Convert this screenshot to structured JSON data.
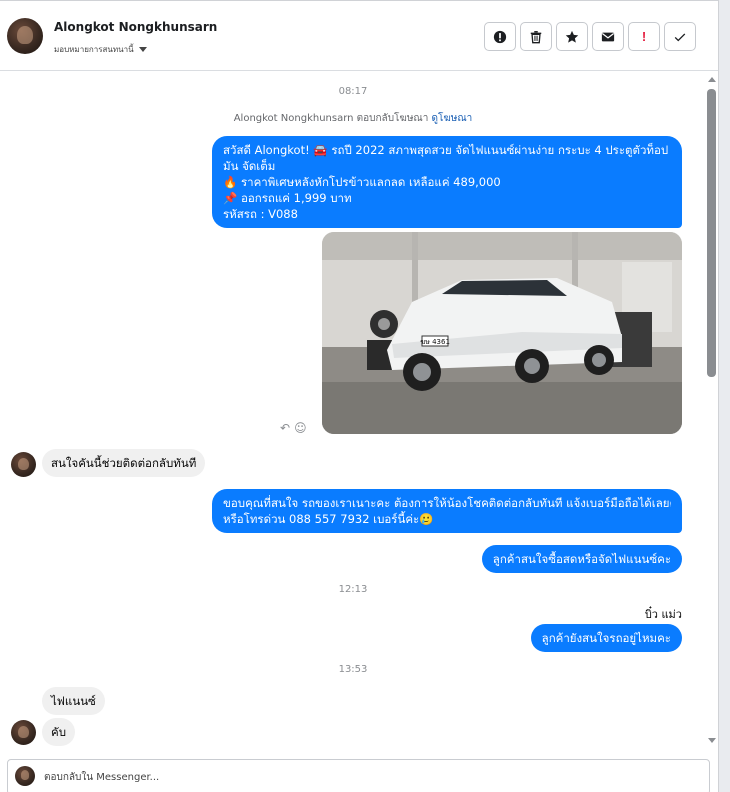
{
  "header": {
    "contact_name": "Alongkot Nongkhunsarn",
    "assign_label": "มอบหมายการสนทนานี้",
    "actions": [
      {
        "icon": "alert-circle-icon",
        "label": ""
      },
      {
        "icon": "trash-icon",
        "label": ""
      },
      {
        "icon": "star-icon",
        "label": ""
      },
      {
        "icon": "envelope-icon",
        "label": ""
      },
      {
        "icon": "exclamation-icon",
        "label": "!"
      },
      {
        "icon": "checkmark-icon",
        "label": ""
      }
    ]
  },
  "thread": {
    "timestamps": [
      "08:17",
      "12:13",
      "13:53"
    ],
    "ad_note": {
      "text": "Alongkot Nongkhunsarn ตอบกลับโฆษณา",
      "link": "ดูโฆษณา"
    },
    "promo_lines": [
      "สวัสดี Alongkot! 🚘 รถปี 2022 สภาพสุดสวย จัดไฟแนนซ์ผ่านง่าย กระบะ 4 ประตูตัวท็อป ขับ",
      "มัน จัดเต็ม",
      "🔥 ราคาพิเศษหลังหักโปรข้าวแลกลด เหลือแค่ 489,000",
      "📌 ออกรถแค่ 1,999 บาท",
      "รหัสรถ : V088"
    ],
    "car_plate": "ฆษ 4361",
    "msg_interest": "สนใจคันนี้ช่วยติดต่อกลับทันที",
    "reply_thanks_1": "ขอบคุณที่สนใจ รถของเราเนาะคะ ต้องการให้น้องโชคติดต่อกลับทันที แจ้งเบอร์มือถือได้เลยค่ะ",
    "reply_thanks_2": "หรือโทรด่วน 088 557 7932 เบอร์นี้ค่ะ🥲",
    "reply_cash_or_finance": "ลูกค้าสนใจซื้อสดหรือจัดไฟแนนซ์คะ",
    "signer": "บิ๋ว แม่ว",
    "reply_still_interested": "ลูกค้ายังสนใจรถอยู่ไหมคะ",
    "msg_finance": "ไฟแนนซ์",
    "msg_yes": "คับ"
  },
  "composer": {
    "placeholder": "ตอบกลับใน Messenger..."
  }
}
